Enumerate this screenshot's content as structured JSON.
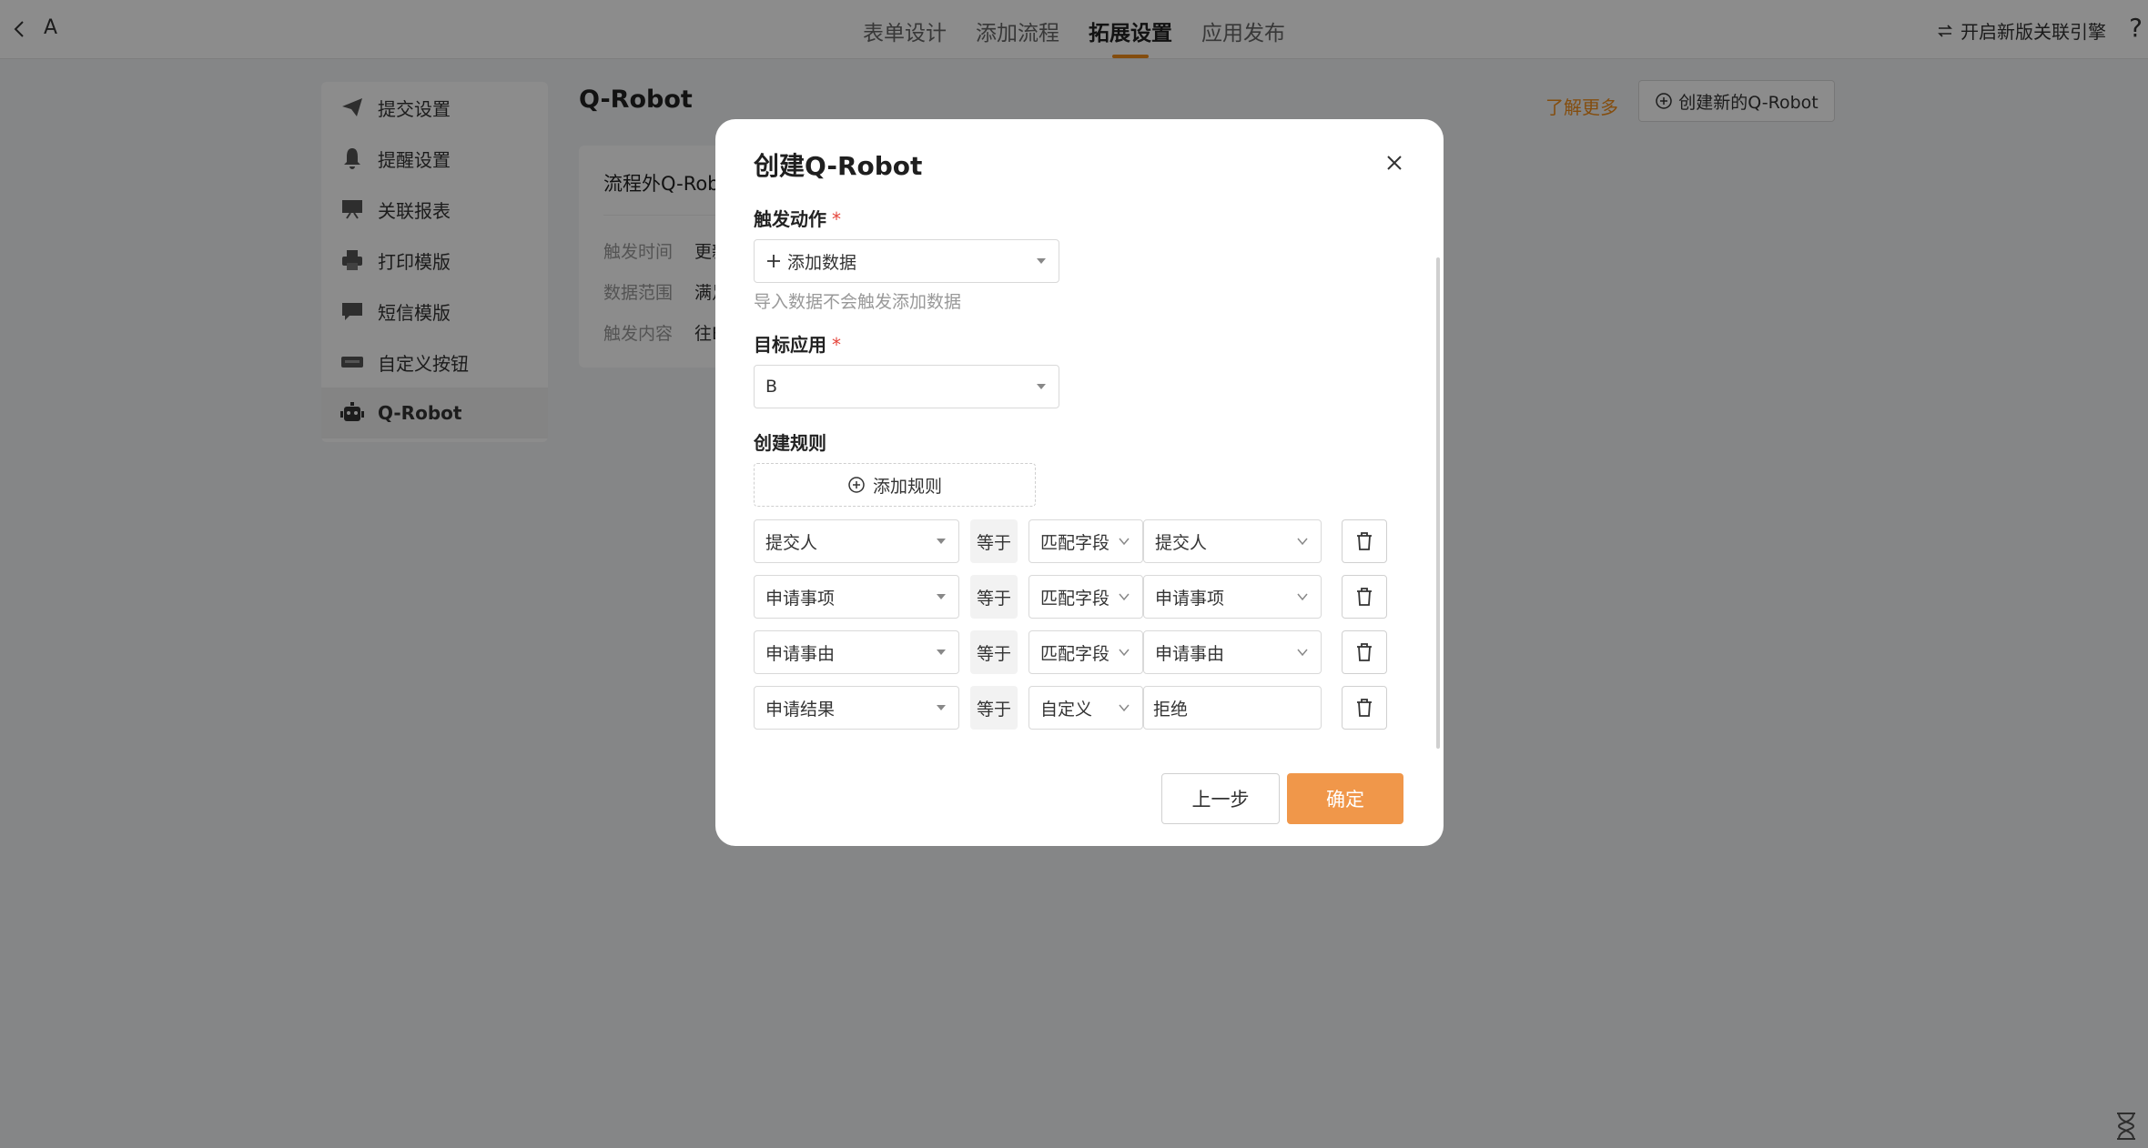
{
  "header": {
    "app_name": "A",
    "tabs": [
      {
        "label": "表单设计"
      },
      {
        "label": "添加流程"
      },
      {
        "label": "拓展设置"
      },
      {
        "label": "应用发布"
      }
    ],
    "engine_link": "开启新版关联引擎",
    "help": "?"
  },
  "sidebar": {
    "items": [
      {
        "label": "提交设置"
      },
      {
        "label": "提醒设置"
      },
      {
        "label": "关联报表"
      },
      {
        "label": "打印模版"
      },
      {
        "label": "短信模版"
      },
      {
        "label": "自定义按钮"
      },
      {
        "label": "Q-Robot"
      }
    ]
  },
  "main": {
    "title": "Q-Robot",
    "learn_more": "了解更多",
    "new_robot": "创建新的Q-Robot",
    "card": {
      "title": "流程外Q-Rob",
      "rows": [
        {
          "key": "触发时间",
          "value": "更新"
        },
        {
          "key": "数据范围",
          "value": "满足"
        },
        {
          "key": "触发内容",
          "value": "往B"
        }
      ]
    }
  },
  "modal": {
    "title": "创建Q-Robot",
    "trigger_label": "触发动作",
    "required_mark": "*",
    "trigger_value": "添加数据",
    "trigger_hint": "导入数据不会触发添加数据",
    "target_label": "目标应用",
    "target_value": "B",
    "rules_label": "创建规则",
    "add_rule": "添加规则",
    "equals": "等于",
    "rules": [
      {
        "field": "提交人",
        "mode": "匹配字段",
        "value": "提交人"
      },
      {
        "field": "申请事项",
        "mode": "匹配字段",
        "value": "申请事项"
      },
      {
        "field": "申请事由",
        "mode": "匹配字段",
        "value": "申请事由"
      },
      {
        "field": "申请结果",
        "mode": "自定义",
        "value": "拒绝"
      }
    ],
    "prev_button": "上一步",
    "ok_button": "确定"
  },
  "colors": {
    "accent": "#f08c1a",
    "primary_button": "#f0974a",
    "required": "#e5453b"
  }
}
